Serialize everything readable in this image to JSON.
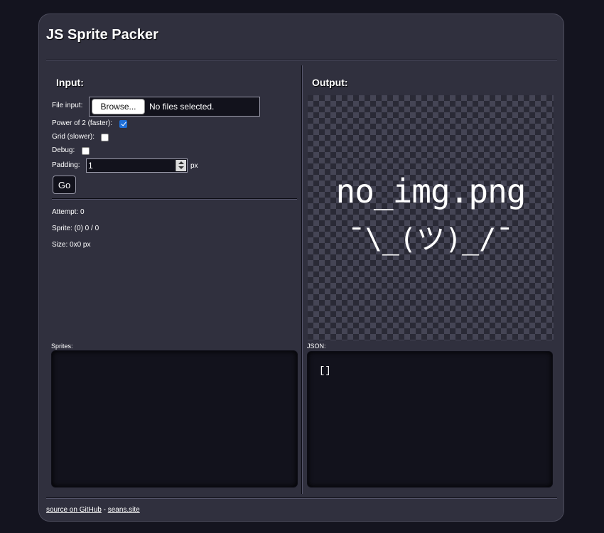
{
  "app": {
    "title": "JS Sprite Packer"
  },
  "input": {
    "title": "Input:",
    "file_label": "File input:",
    "browse_label": "Browse...",
    "file_status": "No files selected.",
    "power_of_two_label": "Power of 2 (faster):",
    "power_of_two_checked": true,
    "grid_label": "Grid (slower):",
    "grid_checked": false,
    "debug_label": "Debug:",
    "debug_checked": false,
    "padding_label": "Padding:",
    "padding_value": "1",
    "padding_unit": "px",
    "go_label": "Go"
  },
  "stats": {
    "attempt": "Attempt: 0",
    "sprite": "Sprite: (0) 0 / 0",
    "size": "Size: 0x0 px"
  },
  "sprites": {
    "label": "Sprites:"
  },
  "output": {
    "title": "Output:",
    "image_text_line1": "no_img.png",
    "image_text_line2": "¯\\_(ツ)_/¯"
  },
  "json": {
    "label": "JSON:",
    "content": "[]"
  },
  "footer": {
    "source_link": "source on GitHub",
    "separator": " - ",
    "site_link": "seans.site"
  },
  "colors": {
    "page_bg": "#14141f",
    "card_bg": "#30303e",
    "field_bg": "#12121c",
    "accent": "#1e6fd9"
  }
}
